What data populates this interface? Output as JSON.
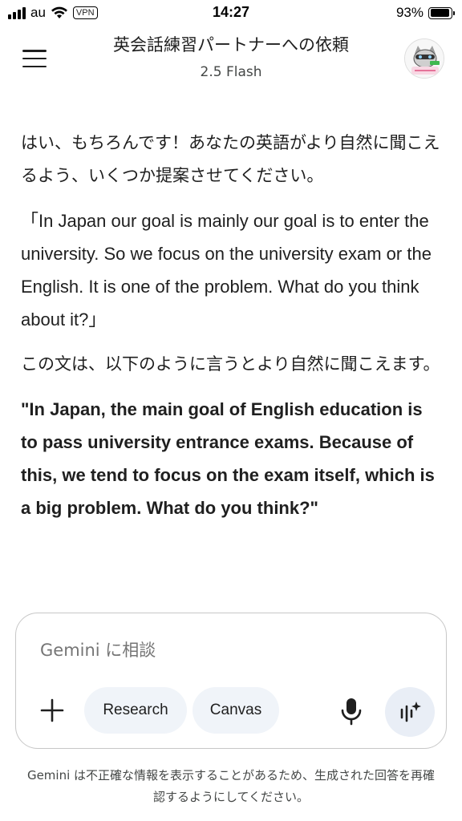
{
  "status_bar": {
    "carrier": "au",
    "vpn_label": "VPN",
    "time": "14:27",
    "battery_percent": "93%",
    "battery_level": 0.93
  },
  "header": {
    "title": "英会話練習パートナーへの依頼",
    "subtitle": "2.5 Flash",
    "avatar_icon": "profile-avatar-icon"
  },
  "messages": [
    "はい、もちろんです！あなたの英語がより自然に聞こえるよう、いくつか提案させてください。",
    "「In Japan our goal is mainly our goal is to enter the university. So we focus on the university exam or the English. It is one of the problem. What do you think about it?」",
    "この文は、以下のように言うとより自然に聞こえます。",
    "\"In Japan, the main goal of English education is to pass university entrance exams. Because of this, we tend to focus on the exam itself, which is a big problem. What do you think?\""
  ],
  "composer": {
    "placeholder": "Gemini に相談",
    "research_label": "Research",
    "canvas_label": "Canvas"
  },
  "disclaimer": "Gemini は不正確な情報を表示することがあるため、生成された回答を再確認するようにしてください。"
}
